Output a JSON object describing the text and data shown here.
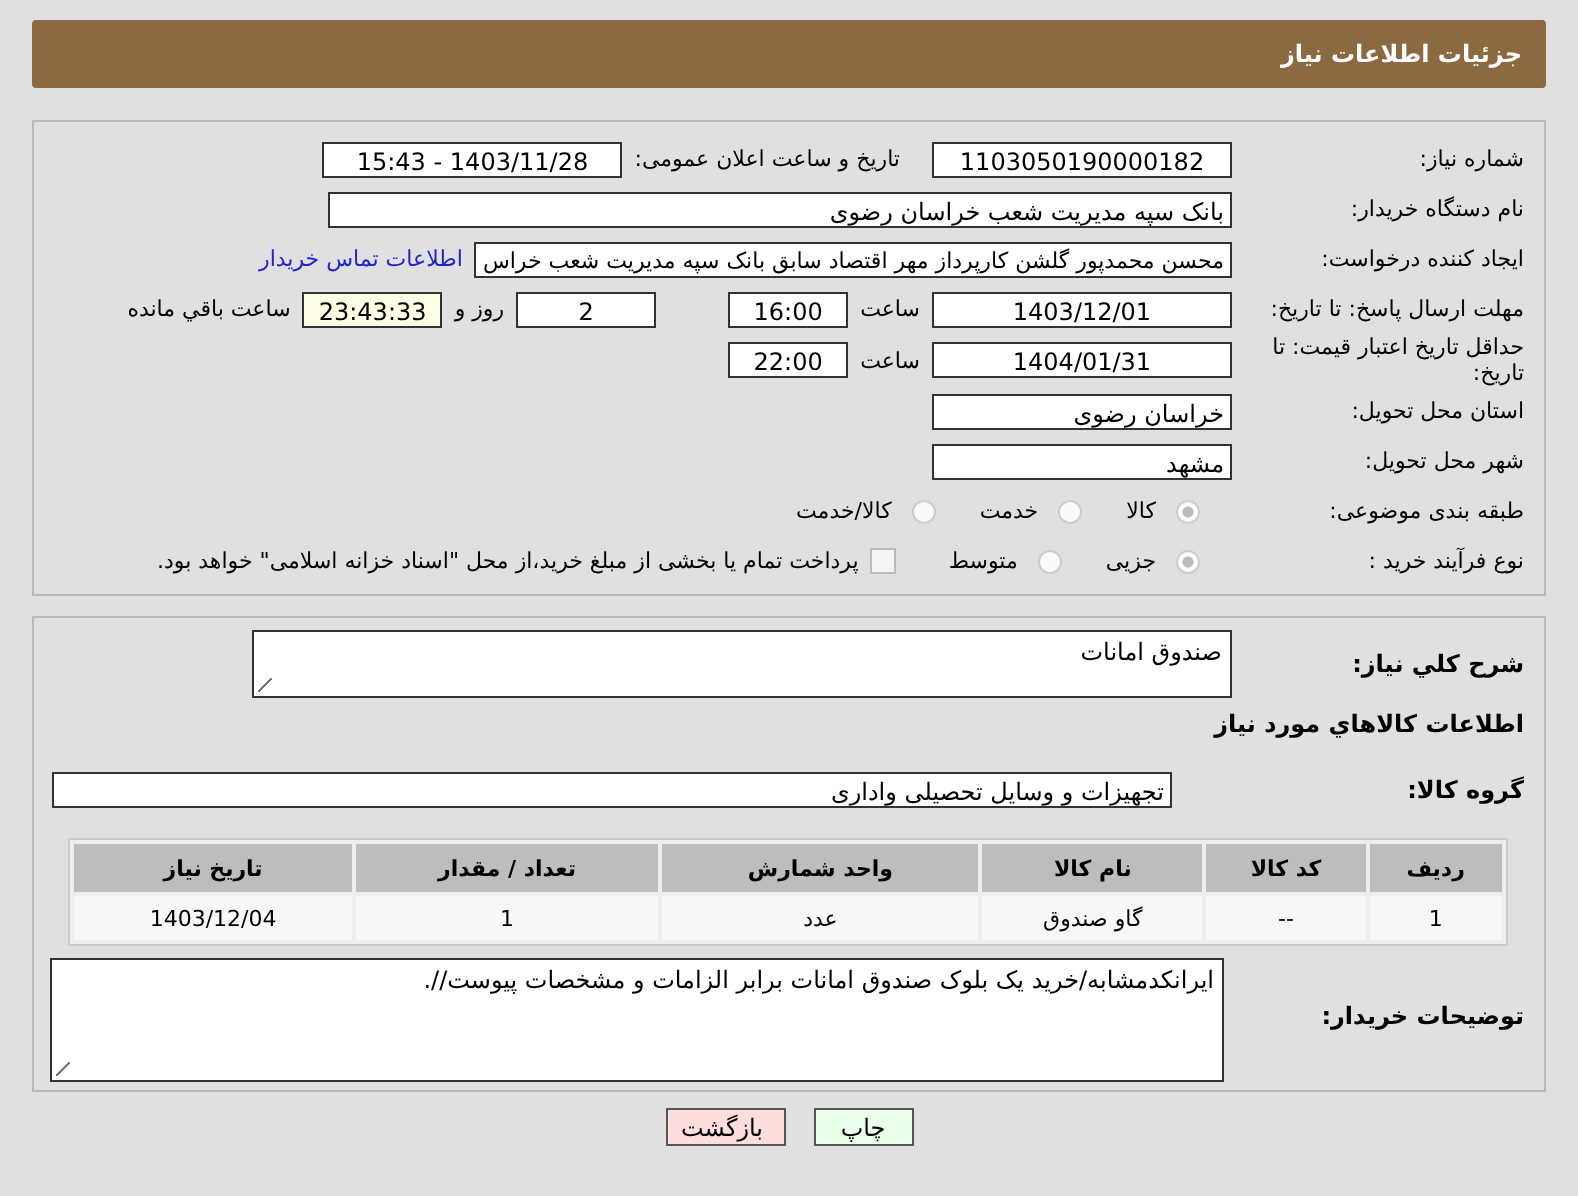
{
  "header": {
    "title": "جزئیات اطلاعات نیاز"
  },
  "details": {
    "need_number": {
      "label": "شماره نیاز:",
      "value": "1103050190000182"
    },
    "announce": {
      "label": "تاریخ و ساعت اعلان عمومی:",
      "value": "1403/11/28 - 15:43"
    },
    "buyer_org": {
      "label": "نام دستگاه خریدار:",
      "value": "بانک سپه مدیریت شعب خراسان رضوی"
    },
    "creator": {
      "label": "ایجاد کننده درخواست:",
      "value": "محسن محمدپور گلشن کارپرداز مهر اقتصاد سابق بانک سپه مدیریت شعب خراس",
      "link": "اطلاعات تماس خریدار"
    },
    "response_deadline": {
      "label": "مهلت ارسال پاسخ: تا تاریخ:",
      "date": "1403/12/01",
      "time_label": "ساعت",
      "time": "16:00",
      "days": "2",
      "days_label": "روز و",
      "remaining": "23:43:33",
      "remaining_label": "ساعت باقي مانده"
    },
    "price_validity": {
      "label": "حداقل تاریخ اعتبار قیمت: تا تاریخ:",
      "date": "1404/01/31",
      "time_label": "ساعت",
      "time": "22:00"
    },
    "delivery_province": {
      "label": "استان محل تحویل:",
      "value": "خراسان رضوی"
    },
    "delivery_city": {
      "label": "شهر محل تحویل:",
      "value": "مشهد"
    },
    "category": {
      "label": "طبقه بندی موضوعی:",
      "options": [
        {
          "label": "کالا",
          "selected": true
        },
        {
          "label": "خدمت",
          "selected": false
        },
        {
          "label": "کالا/خدمت",
          "selected": false
        }
      ]
    },
    "purchase_type": {
      "label": "نوع فرآیند خرید :",
      "options": [
        {
          "label": "جزیی",
          "selected": true
        },
        {
          "label": "متوسط",
          "selected": false
        }
      ],
      "treasury_payment": {
        "label": "پرداخت تمام یا بخشی از مبلغ خرید،از محل \"اسناد خزانه اسلامی\" خواهد بود.",
        "checked": false
      }
    }
  },
  "goods": {
    "description": {
      "label": "شرح کلي نياز:",
      "value": "صندوق امانات"
    },
    "section_title": "اطلاعات کالاهاي مورد نياز",
    "group": {
      "label": "گروه کالا:",
      "value": "تجهیزات و وسایل تحصیلی واداری"
    },
    "table": {
      "columns": [
        "ردیف",
        "کد کالا",
        "نام کالا",
        "واحد شمارش",
        "تعداد / مقدار",
        "تاریخ نیاز"
      ],
      "rows": [
        [
          "1",
          "--",
          "گاو صندوق",
          "عدد",
          "1",
          "1403/12/04"
        ]
      ]
    },
    "buyer_notes": {
      "label": "توضیحات خریدار:",
      "value": "ایرانکدمشابه/خرید یک بلوک صندوق امانات برابر الزامات و مشخصات پیوست//."
    }
  },
  "buttons": [
    {
      "label": "چاپ",
      "kind": "print"
    },
    {
      "label": "بازگشت",
      "kind": "back"
    }
  ]
}
